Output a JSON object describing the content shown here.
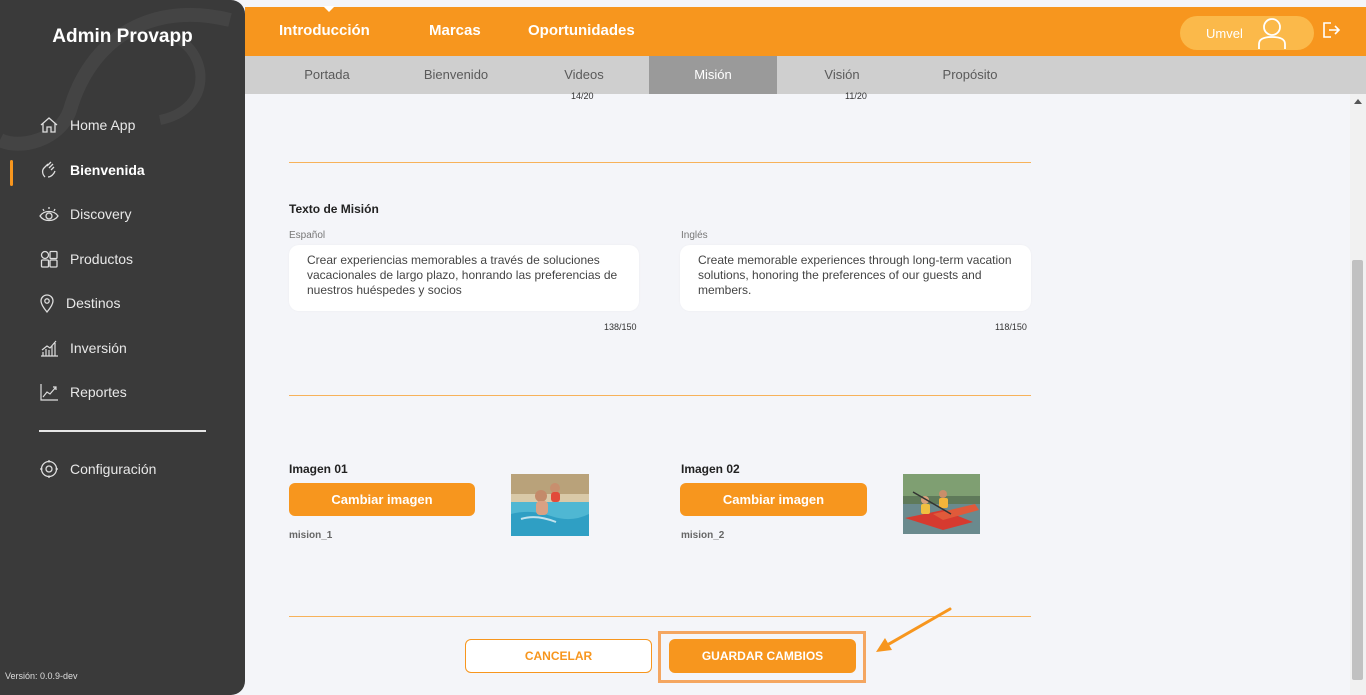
{
  "sidebar": {
    "brand": "Admin Provapp",
    "items": [
      {
        "label": "Home App",
        "icon": "home-icon"
      },
      {
        "label": "Bienvenida",
        "icon": "waving-hand-icon",
        "active": true
      },
      {
        "label": "Discovery",
        "icon": "eye-icon"
      },
      {
        "label": "Productos",
        "icon": "grid-icon"
      },
      {
        "label": "Destinos",
        "icon": "map-pin-icon"
      },
      {
        "label": "Inversión",
        "icon": "bar-chart-icon"
      },
      {
        "label": "Reportes",
        "icon": "line-chart-icon"
      }
    ],
    "settings": {
      "label": "Configuración",
      "icon": "gear-icon"
    },
    "version": "Versión: 0.0.9-dev"
  },
  "topbar": {
    "tabs": [
      "Introducción",
      "Marcas",
      "Oportunidades"
    ],
    "user": "Umvel",
    "logout_icon": "logout-icon"
  },
  "subtabs": {
    "items": [
      "Portada",
      "Bienvenido",
      "Videos",
      "Misión",
      "Visión",
      "Propósito"
    ],
    "active": "Misión"
  },
  "top_counters": {
    "left": "14/20",
    "right": "11/20"
  },
  "mission_text": {
    "title": "Texto de Misión",
    "es_label": "Español",
    "es_value": "Crear experiencias memorables a través de soluciones vacacionales de largo plazo, honrando las preferencias de nuestros huéspedes y socios",
    "es_count": "138/150",
    "en_label": "Inglés",
    "en_value": "Create memorable experiences through long-term vacation solutions, honoring the preferences of our guests and members.",
    "en_count": "118/150"
  },
  "images": [
    {
      "title": "Imagen 01",
      "button": "Cambiar imagen",
      "filename": "mision_1"
    },
    {
      "title": "Imagen 02",
      "button": "Cambiar imagen",
      "filename": "mision_2"
    }
  ],
  "actions": {
    "cancel": "CANCELAR",
    "save": "GUARDAR CAMBIOS"
  },
  "colors": {
    "accent": "#f7961e",
    "sidebar": "#3a3a3a",
    "subtab_active": "#9a9a9a"
  }
}
